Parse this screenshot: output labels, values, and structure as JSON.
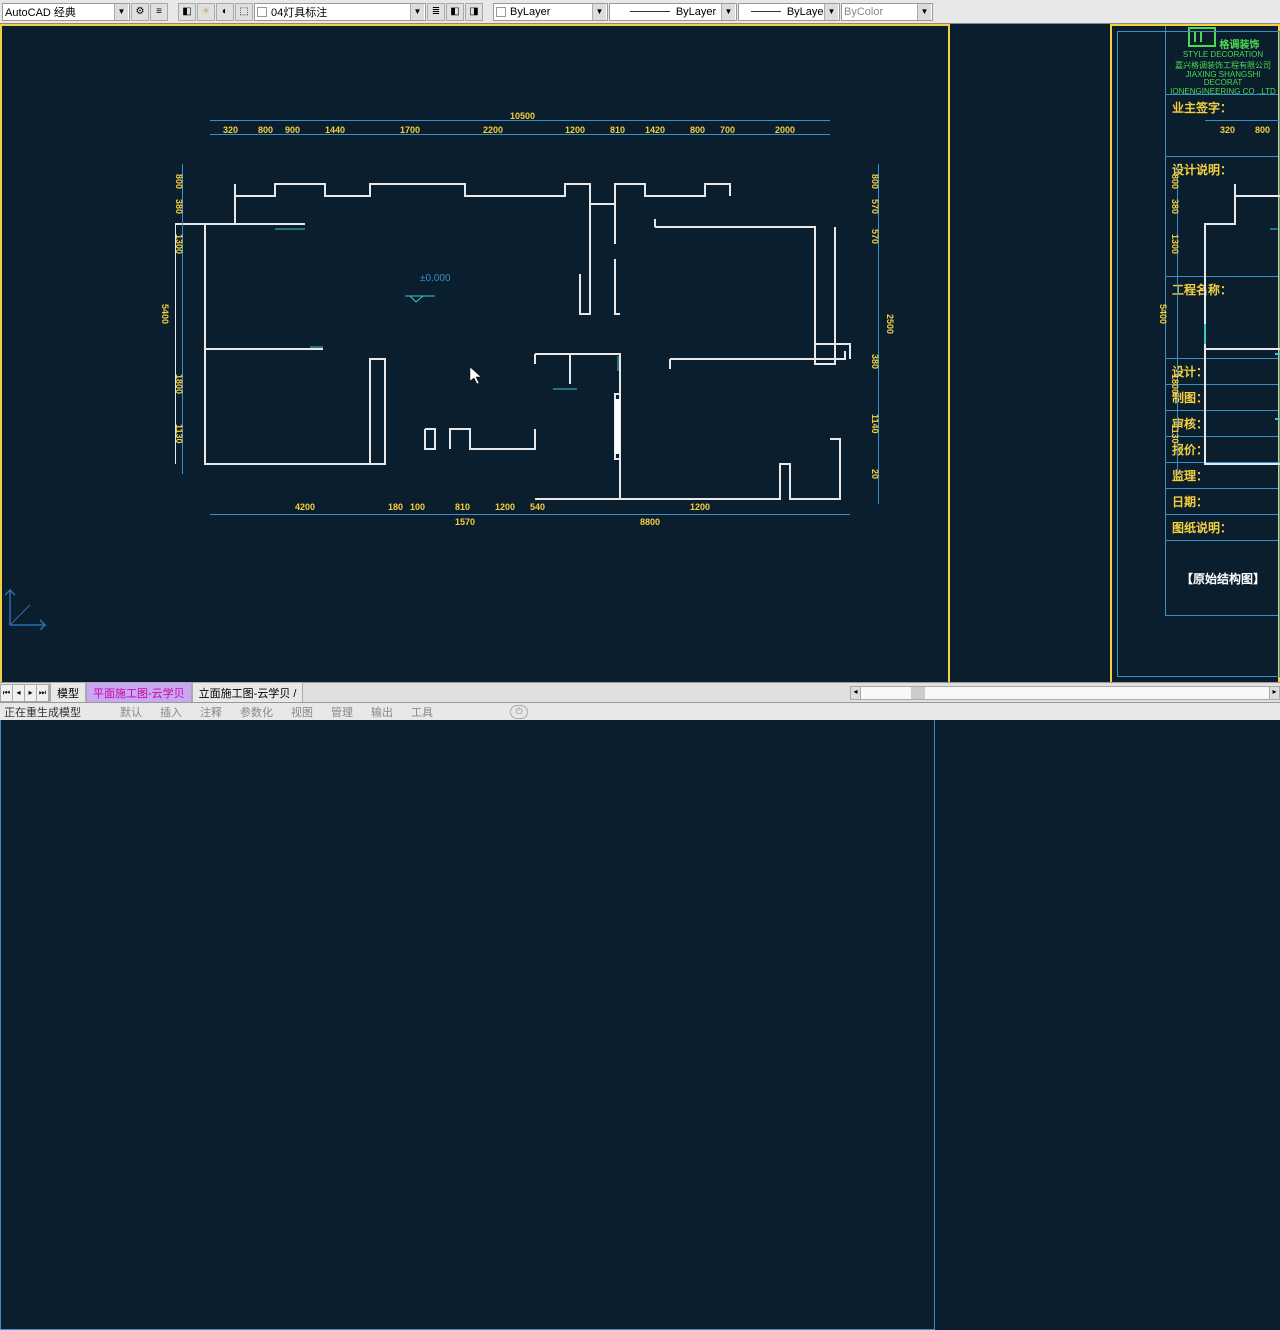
{
  "toolbar": {
    "workspace": "AutoCAD 经典",
    "layer": "04灯具标注",
    "bylayer1": "ByLayer",
    "bylayer2": "ByLayer",
    "bylayer3": "ByLayer",
    "bycolor": "ByColor"
  },
  "titleblock": {
    "logo_name": "格调装饰",
    "logo_sub": "STYLE DECORATION",
    "company1": "嘉兴格调装饰工程有限公司",
    "company2": "JIAXING SHANGSHI DECORAT",
    "company3": "IONENGINEERING CO .,LTD",
    "owner_sign": "业主签字：",
    "design_desc": "设计说明：",
    "project_name": "工程名称：",
    "designer": "设计：",
    "drawer": "制图：",
    "reviewer": "审核：",
    "quote": "报价：",
    "supervisor": "监理：",
    "date": "日期：",
    "drawing_desc": "图纸说明：",
    "drawing_title": "【原始结构图】"
  },
  "dimensions": {
    "top_total": "10500",
    "top": [
      "320",
      "800",
      "900",
      "1440",
      "1700",
      "2200",
      "1200",
      "810",
      "1420",
      "800",
      "700",
      "2000"
    ],
    "left": [
      "800",
      "380",
      "1300",
      "5400",
      "1800",
      "1130"
    ],
    "right": [
      "800",
      "570",
      "570",
      "2500",
      "380",
      "1140",
      "20"
    ],
    "bottom": [
      "4200",
      "100",
      "810",
      "1200",
      "1200"
    ],
    "bottom2": [
      "180",
      "1570",
      "540",
      "8800"
    ]
  },
  "level_marker": "±0.000",
  "tabs": {
    "model": "模型",
    "tab1": "平面施工图-云学贝",
    "tab2": "立面施工图-云学贝"
  },
  "cmdline": {
    "status": "正在重生成模型",
    "menu": [
      "默认",
      "插入",
      "注释",
      "参数化",
      "视图",
      "管理",
      "输出",
      "工具"
    ]
  }
}
